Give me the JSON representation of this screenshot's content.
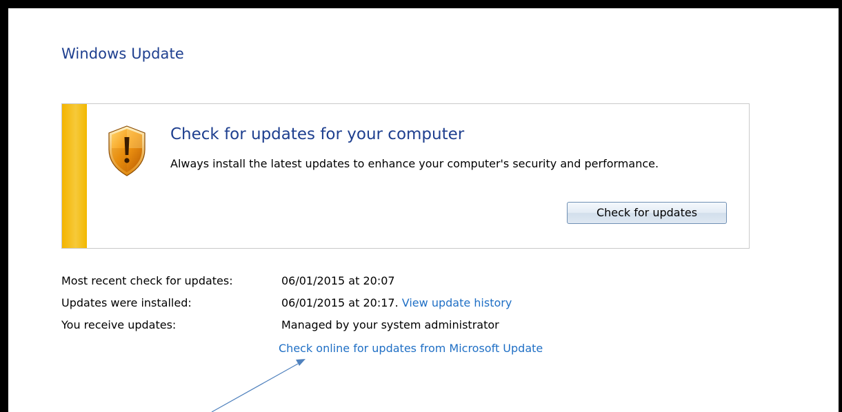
{
  "window": {
    "title": "Windows Update"
  },
  "panel": {
    "heading": "Check for updates for your computer",
    "description": "Always install the latest updates to enhance your computer's security and performance.",
    "button_label": "Check for updates",
    "accent_color": "#f4b400",
    "icon": "warning-shield-icon"
  },
  "info": {
    "rows": [
      {
        "label": "Most recent check for updates:",
        "value": "06/01/2015 at 20:07"
      },
      {
        "label": "Updates were installed:",
        "value": "06/01/2015 at 20:17.",
        "link": "View update history"
      },
      {
        "label": "You receive updates:",
        "value": "Managed by your system administrator"
      }
    ],
    "online_link": "Check online for updates from Microsoft Update"
  },
  "colors": {
    "title_blue": "#1e3f8f",
    "link_blue": "#1f6fc5",
    "annotation_arrow": "#4f81bd"
  }
}
